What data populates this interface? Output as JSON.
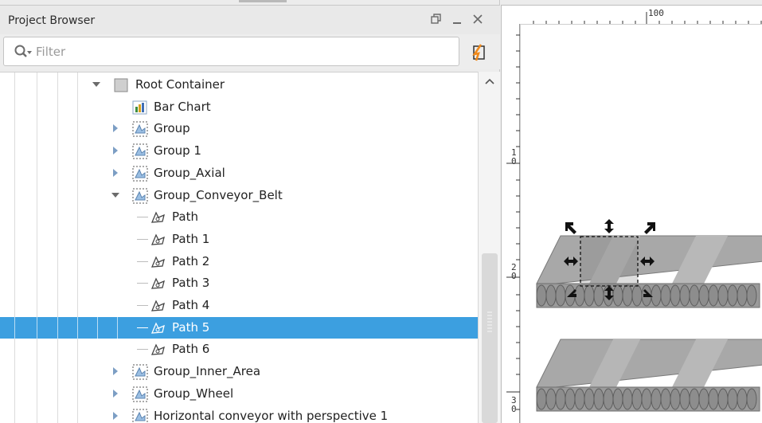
{
  "project_browser": {
    "title": "Project Browser",
    "filter_placeholder": "Filter",
    "restore_glyph": "⧉",
    "minimize_glyph": "_",
    "close_glyph": "✕",
    "tree": [
      {
        "label": "Root Container",
        "icon": "container-icon",
        "expander": "expanded",
        "indent": 0
      },
      {
        "label": "Bar Chart",
        "icon": "bar-chart-icon",
        "expander": "none",
        "indent": 1
      },
      {
        "label": "Group",
        "icon": "group-icon",
        "expander": "collapsed",
        "indent": 1
      },
      {
        "label": "Group 1",
        "icon": "group-icon",
        "expander": "collapsed",
        "indent": 1
      },
      {
        "label": "Group_Axial",
        "icon": "group-icon",
        "expander": "collapsed",
        "indent": 1
      },
      {
        "label": "Group_Conveyor_Belt",
        "icon": "group-icon",
        "expander": "expanded",
        "indent": 1
      },
      {
        "label": "Path",
        "icon": "path-icon",
        "expander": "none",
        "indent": 2
      },
      {
        "label": "Path 1",
        "icon": "path-icon",
        "expander": "none",
        "indent": 2
      },
      {
        "label": "Path 2",
        "icon": "path-icon",
        "expander": "none",
        "indent": 2
      },
      {
        "label": "Path 3",
        "icon": "path-icon",
        "expander": "none",
        "indent": 2
      },
      {
        "label": "Path 4",
        "icon": "path-icon",
        "expander": "none",
        "indent": 2
      },
      {
        "label": "Path 5",
        "icon": "path-icon",
        "expander": "none",
        "indent": 2,
        "selected": true
      },
      {
        "label": "Path 6",
        "icon": "path-icon",
        "expander": "none",
        "indent": 2
      },
      {
        "label": "Group_Inner_Area",
        "icon": "group-icon",
        "expander": "collapsed",
        "indent": 1
      },
      {
        "label": "Group_Wheel",
        "icon": "group-icon",
        "expander": "collapsed",
        "indent": 1
      },
      {
        "label": "Horizontal conveyor with perspective 1",
        "icon": "group-icon",
        "expander": "collapsed",
        "indent": 1
      }
    ]
  },
  "designer": {
    "ruler_top_label": "100",
    "ruler_left_labels": [
      "1\n0",
      "2\n0",
      "3\n0"
    ]
  },
  "colors": {
    "selection": "#3c9fe0",
    "conveyor_top": "#a9a9a9",
    "conveyor_stripe": "#bcbcbc",
    "conveyor_roller": "#8a8a8a"
  }
}
